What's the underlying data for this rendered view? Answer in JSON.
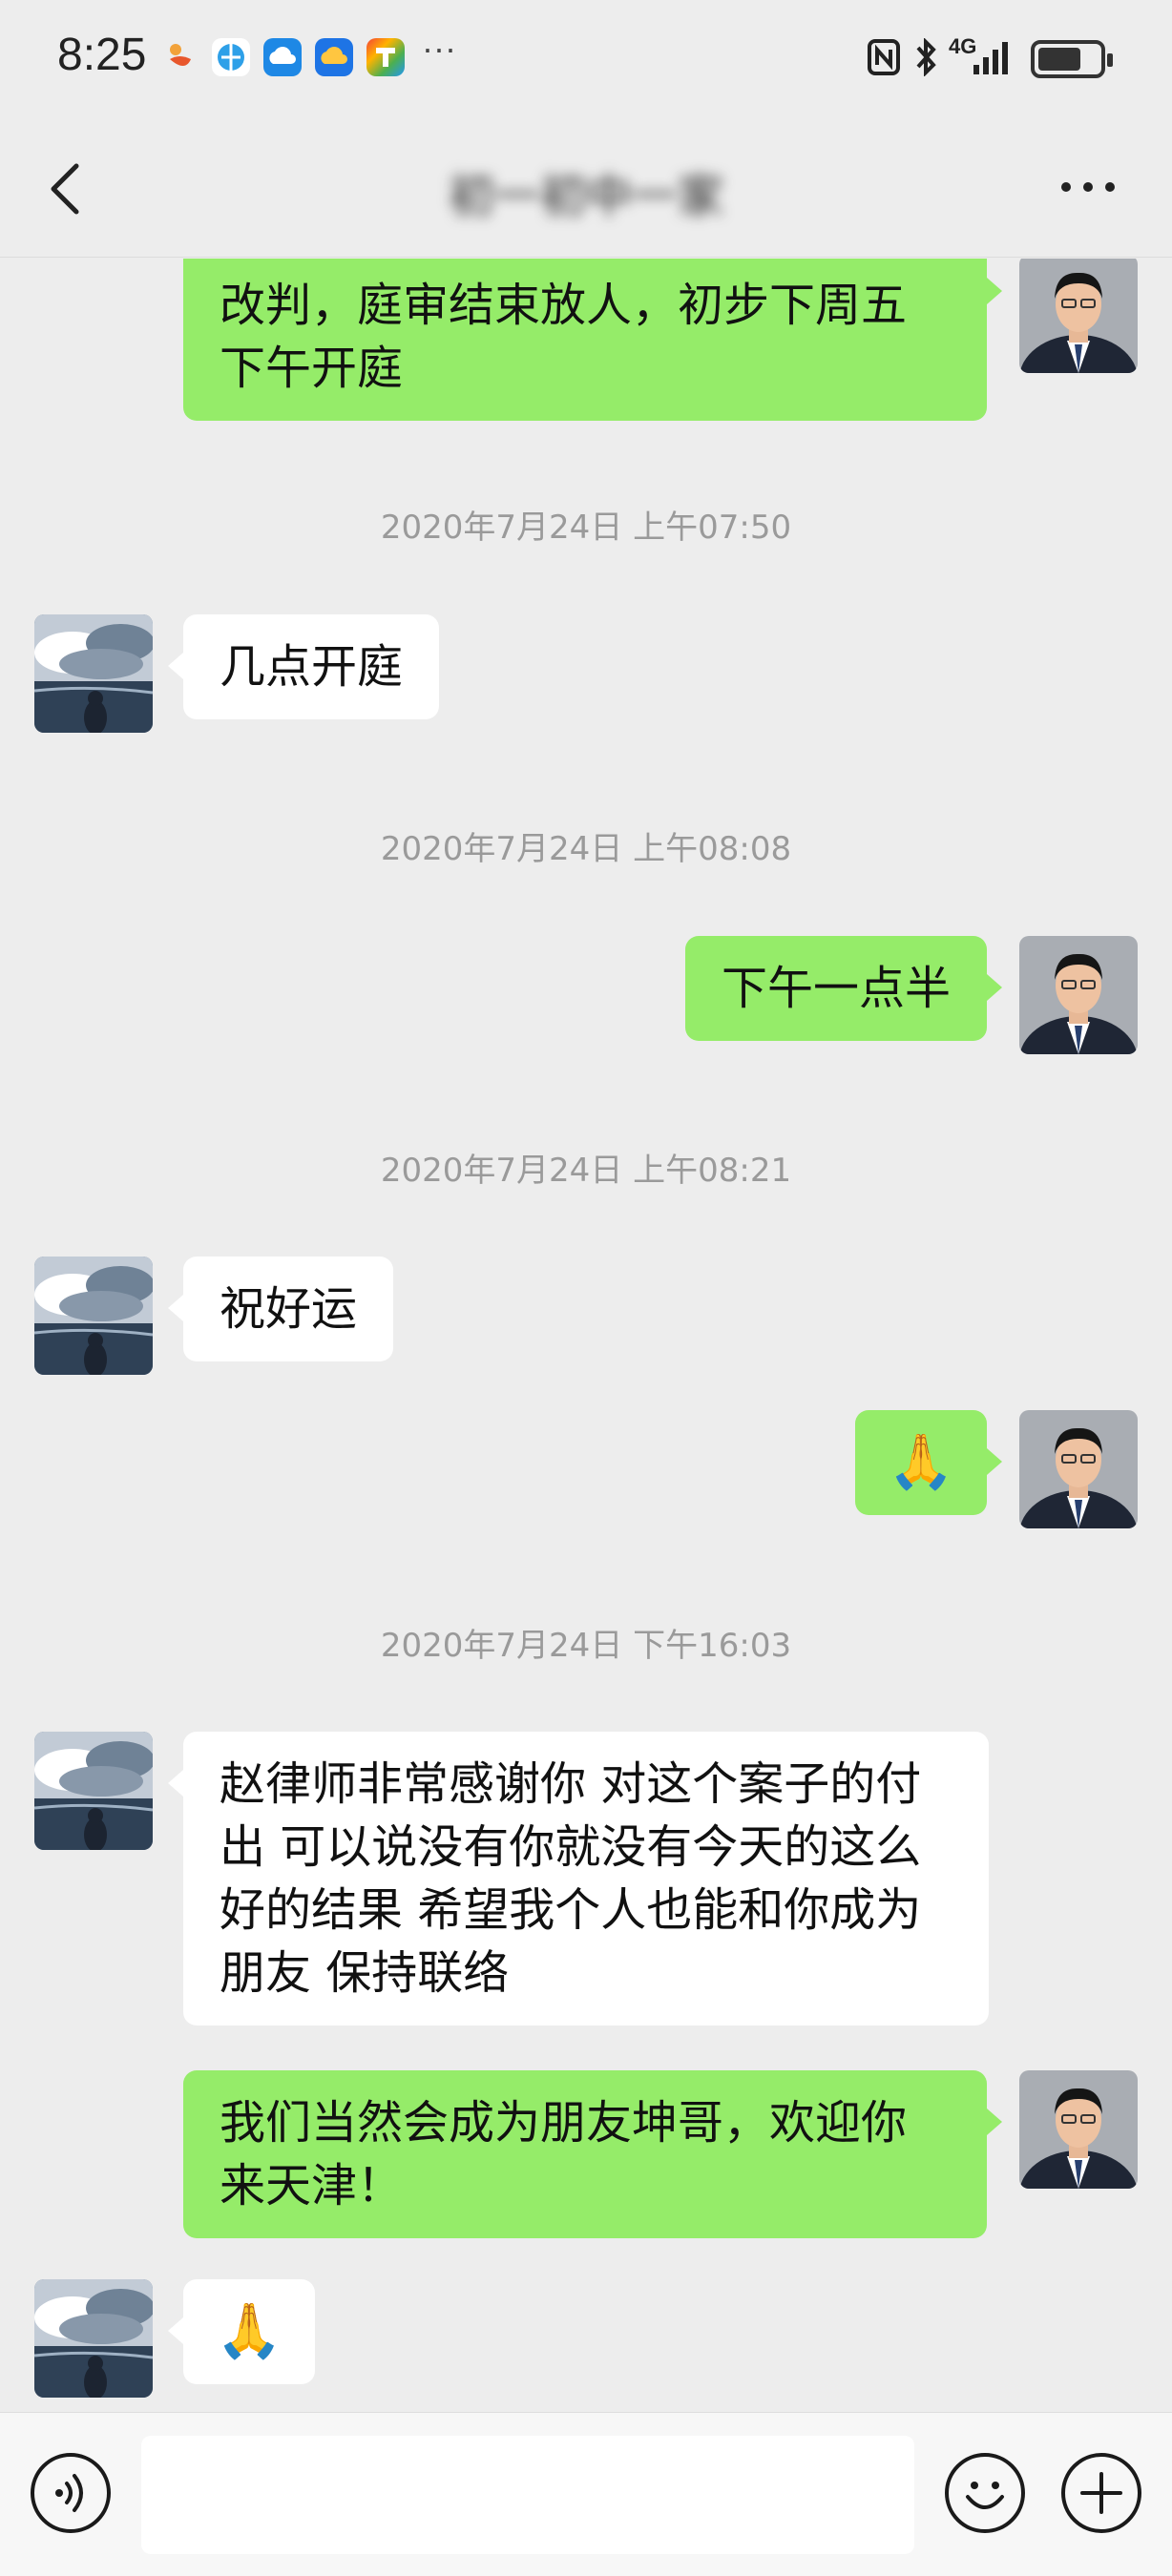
{
  "status_bar": {
    "time": "8:25",
    "overflow_dots": "···",
    "network_label": "4G",
    "icons": [
      "app-notification-icon",
      "browser-icon",
      "cloud-icon",
      "cloud-drive-icon",
      "colorful-app-icon",
      "nfc-icon",
      "bluetooth-icon",
      "signal-icon",
      "battery-icon"
    ]
  },
  "nav": {
    "title": "初一初中一家",
    "back_icon": "chevron-left-icon",
    "more_icon": "more-dots-icon"
  },
  "messages": [
    {
      "type": "text",
      "side": "right",
      "text_lines": [
        "改判，庭审结束放人，初步下周五",
        "下午开庭"
      ]
    },
    {
      "type": "timestamp",
      "text": "2020年7月24日 上午07:50"
    },
    {
      "type": "text",
      "side": "left",
      "text_lines": [
        "几点开庭"
      ]
    },
    {
      "type": "timestamp",
      "text": "2020年7月24日 上午08:08"
    },
    {
      "type": "text",
      "side": "right",
      "text_lines": [
        "下午一点半"
      ]
    },
    {
      "type": "timestamp",
      "text": "2020年7月24日 上午08:21"
    },
    {
      "type": "text",
      "side": "left",
      "text_lines": [
        "祝好运"
      ]
    },
    {
      "type": "emoji",
      "side": "right",
      "text_lines": [
        "🙏"
      ]
    },
    {
      "type": "timestamp",
      "text": "2020年7月24日 下午16:03"
    },
    {
      "type": "text",
      "side": "left",
      "text_lines": [
        "赵律师非常感谢你 对这个案子的付",
        "出 可以说没有你就没有今天的这么",
        "好的结果 希望我个人也能和你成为",
        "朋友 保持联络"
      ]
    },
    {
      "type": "text",
      "side": "right",
      "text_lines": [
        "我们当然会成为朋友坤哥，欢迎你",
        "来天津！"
      ]
    },
    {
      "type": "emoji",
      "side": "left",
      "text_lines": [
        "🙏"
      ]
    }
  ],
  "input_bar": {
    "placeholder": "",
    "voice_icon": "voice-icon",
    "emoji_icon": "emoji-icon",
    "plus_icon": "plus-icon"
  },
  "colors": {
    "background": "#ededed",
    "sent_bubble": "#95ec69",
    "received_bubble": "#ffffff",
    "timestamp_text": "#9a9a9a"
  }
}
